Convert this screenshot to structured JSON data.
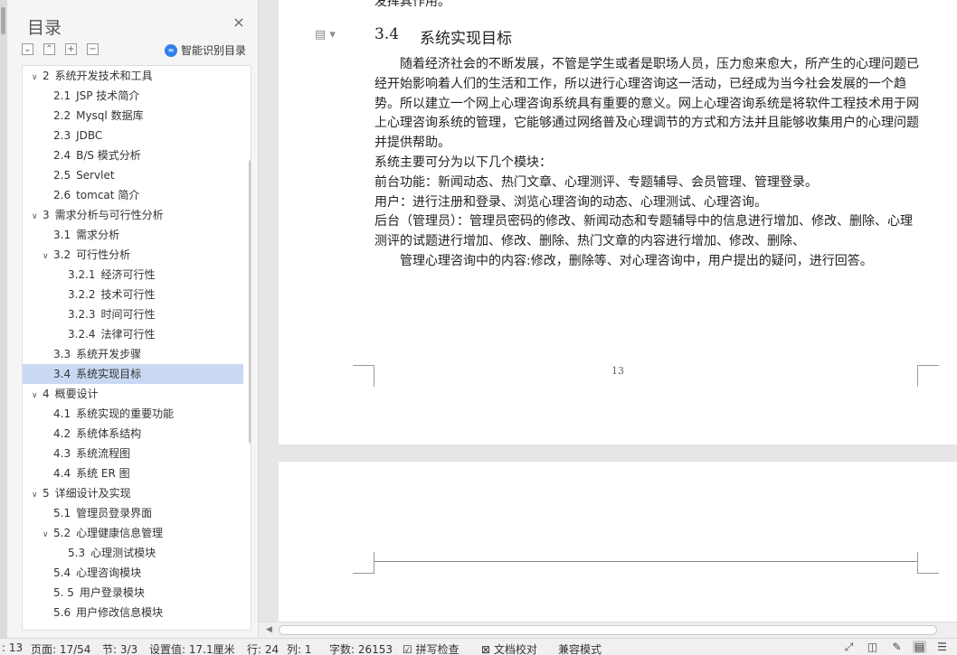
{
  "nav": {
    "title": "目录",
    "smart_toc_label": "智能识别目录",
    "items": [
      {
        "num": "2",
        "text": "系统开发技术和工具",
        "level": 1,
        "expanded": true
      },
      {
        "num": "2.1",
        "text": "JSP 技术简介",
        "level": 2
      },
      {
        "num": "2.2",
        "text": "Mysql 数据库",
        "level": 2
      },
      {
        "num": "2.3",
        "text": "JDBC",
        "level": 2
      },
      {
        "num": "2.4",
        "text": "B/S 模式分析",
        "level": 2
      },
      {
        "num": "2.5",
        "text": "Servlet",
        "level": 2
      },
      {
        "num": "2.6",
        "text": "tomcat 简介",
        "level": 2
      },
      {
        "num": "3",
        "text": "需求分析与可行性分析",
        "level": 1,
        "expanded": true
      },
      {
        "num": "3.1",
        "text": "需求分析",
        "level": 2
      },
      {
        "num": "3.2",
        "text": "可行性分析",
        "level": 2,
        "expanded": true
      },
      {
        "num": "3.2.1",
        "text": "经济可行性",
        "level": 3
      },
      {
        "num": "3.2.2",
        "text": "技术可行性",
        "level": 3
      },
      {
        "num": "3.2.3",
        "text": "时间可行性",
        "level": 3
      },
      {
        "num": "3.2.4",
        "text": "法律可行性",
        "level": 3
      },
      {
        "num": "3.3",
        "text": "系统开发步骤",
        "level": 2
      },
      {
        "num": "3.4",
        "text": "系统实现目标",
        "level": 2,
        "active": true
      },
      {
        "num": "4",
        "text": "概要设计",
        "level": 1,
        "expanded": true
      },
      {
        "num": "4.1",
        "text": "系统实现的重要功能",
        "level": 2
      },
      {
        "num": "4.2",
        "text": "系统体系结构",
        "level": 2
      },
      {
        "num": "4.3",
        "text": "系统流程图",
        "level": 2
      },
      {
        "num": "4.4",
        "text": "系统 ER 图",
        "level": 2
      },
      {
        "num": "5",
        "text": "详细设计及实现",
        "level": 1,
        "expanded": true
      },
      {
        "num": "5.1",
        "text": "管理员登录界面",
        "level": 2
      },
      {
        "num": "5.2",
        "text": "心理健康信息管理",
        "level": 2,
        "expanded": true
      },
      {
        "num": "5.3",
        "text": "心理测试模块",
        "level": 3
      },
      {
        "num": "5.4",
        "text": "心理咨询模块",
        "level": 2
      },
      {
        "num": "5. 5",
        "text": "用户登录模块",
        "level": 2
      },
      {
        "num": "5.6",
        "text": "用户修改信息模块",
        "level": 2
      }
    ]
  },
  "document": {
    "top_cut_text": "发挥其作用。",
    "heading_num": "3.4",
    "heading_text": "系统实现目标",
    "paragraphs": [
      {
        "text": "随着经济社会的不断发展，不管是学生或者是职场人员，压力愈来愈大，所产生的心理问题已经开始影响着人们的生活和工作，所以进行心理咨询这一活动，已经成为当今社会发展的一个趋势。所以建立一个网上心理咨询系统具有重要的意义。网上心理咨询系统是将软件工程技术用于网上心理咨询系统的管理，它能够通过网络普及心理调节的方式和方法并且能够收集用户的心理问题并提供帮助。",
        "indent": true
      },
      {
        "text": "系统主要可分为以下几个模块：",
        "indent": false
      },
      {
        "text": "前台功能：新闻动态、热门文章、心理测评、专题辅导、会员管理、管理登录。",
        "indent": false
      },
      {
        "text": "用户：进行注册和登录、浏览心理咨询的动态、心理测试、心理咨询。",
        "indent": false
      },
      {
        "text": "后台（管理员）：管理员密码的修改、新闻动态和专题辅导中的信息进行增加、修改、删除、心理测评的试题进行增加、修改、删除、热门文章的内容进行增加、修改、删除、",
        "indent": false
      },
      {
        "text": "管理心理咨询中的内容:修改，删除等、对心理咨询中，用户提出的疑问，进行回答。",
        "indent": true
      }
    ],
    "page_number": "13"
  },
  "status": {
    "page_count_cut": ": 13",
    "page": "页面: 17/54",
    "section": "节: 3/3",
    "setting": "设置值: 17.1厘米",
    "row": "行: 24",
    "col": "列: 1",
    "word_count": "字数: 26153",
    "spell_check": "拼写检查",
    "doc_proof": "文档校对",
    "compat_mode": "兼容模式"
  }
}
